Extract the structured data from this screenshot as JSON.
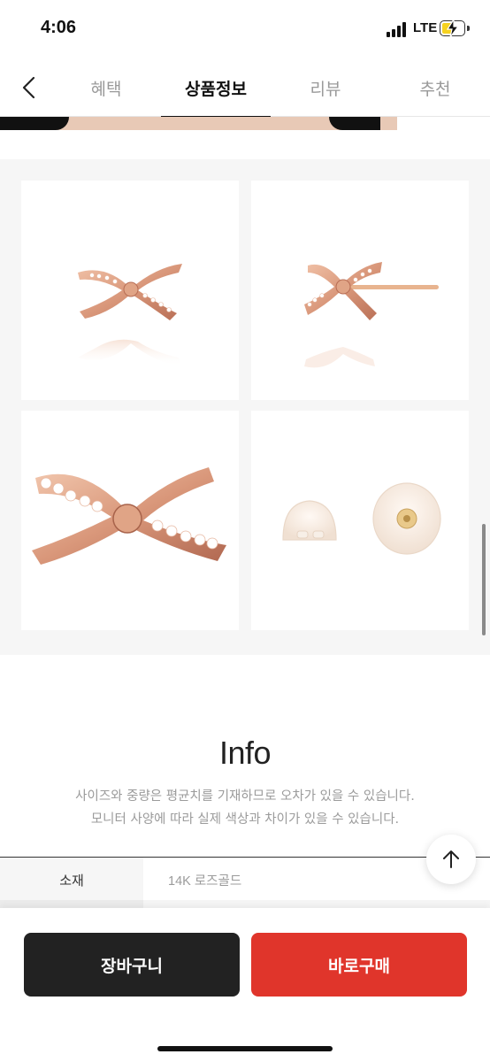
{
  "status_bar": {
    "time": "4:06",
    "network": "LTE",
    "battery_level": 0.55
  },
  "nav": {
    "back_icon": "chevron-left-icon",
    "tabs": [
      {
        "label": "혜택",
        "active": false
      },
      {
        "label": "상품정보",
        "active": true
      },
      {
        "label": "리뷰",
        "active": false
      },
      {
        "label": "추천",
        "active": false
      }
    ]
  },
  "gallery": {
    "images": [
      {
        "name": "bow-earring-front",
        "description_icon": "bow-earring-icon"
      },
      {
        "name": "bow-earring-side",
        "description_icon": "bow-earring-post-icon"
      },
      {
        "name": "bow-earring-closeup",
        "description_icon": "bow-earring-icon"
      },
      {
        "name": "silicone-earring-backs",
        "description_icon": "earring-back-icon"
      }
    ]
  },
  "info": {
    "title": "Info",
    "note_1": "사이즈와 중량은 평균치를 기재하므로 오차가 있을 수 있습니다.",
    "note_2": "모니터 사양에 따라 실제 색상과 차이가 있을 수 있습니다."
  },
  "specs": [
    {
      "label": "소재",
      "value": "14K 로즈골드"
    }
  ],
  "actions": {
    "cart_label": "장바구니",
    "buy_label": "바로구매",
    "scroll_top_icon": "arrow-up-icon"
  },
  "colors": {
    "accent_buy": "#e0352b",
    "cart_dark": "#222222",
    "rose_gold": "#d9977a"
  }
}
